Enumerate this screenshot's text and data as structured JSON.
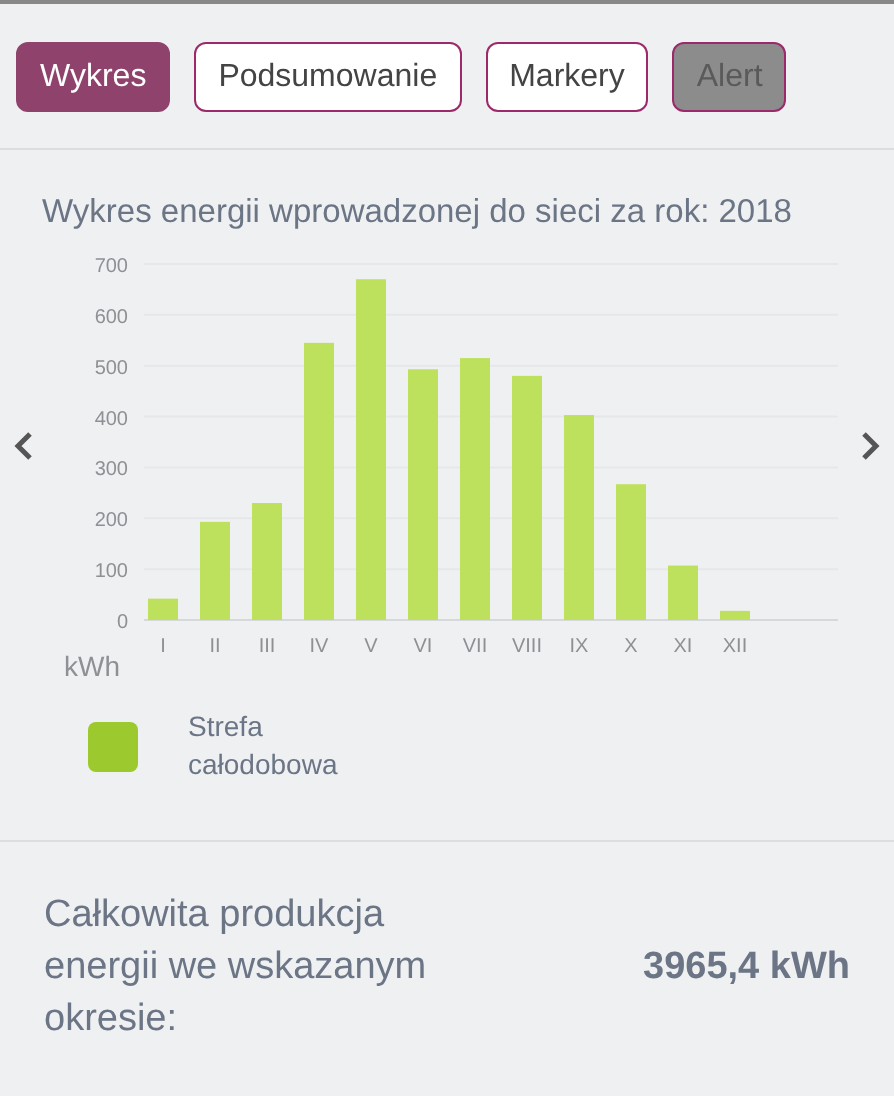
{
  "tabs": [
    {
      "label": "Wykres",
      "selected": true,
      "disabled": false
    },
    {
      "label": "Podsumowanie",
      "selected": false,
      "disabled": false
    },
    {
      "label": "Markery",
      "selected": false,
      "disabled": false
    },
    {
      "label": "Alert",
      "selected": false,
      "disabled": true
    }
  ],
  "chart_title": "Wykres energii wprowadzonej do sieci za rok: 2018",
  "chart_data": {
    "type": "bar",
    "ylabel": "kWh",
    "categories": [
      "I",
      "II",
      "III",
      "IV",
      "V",
      "VI",
      "VII",
      "VIII",
      "IX",
      "X",
      "XI",
      "XII"
    ],
    "series": [
      {
        "name": "Strefa całodobowa",
        "color": "#bde15c",
        "values": [
          42,
          193,
          230,
          545,
          670,
          493,
          515,
          480,
          403,
          267,
          107,
          18
        ]
      }
    ],
    "ylim": [
      0,
      700
    ],
    "yticks": [
      0,
      100,
      200,
      300,
      400,
      500,
      600,
      700
    ],
    "grid": true
  },
  "legend": [
    {
      "color": "#9bc92e"
    }
  ],
  "summary": {
    "label": "Całkowita produkcja energii we wskazanym okresie:",
    "value": "3965,4 kWh"
  }
}
